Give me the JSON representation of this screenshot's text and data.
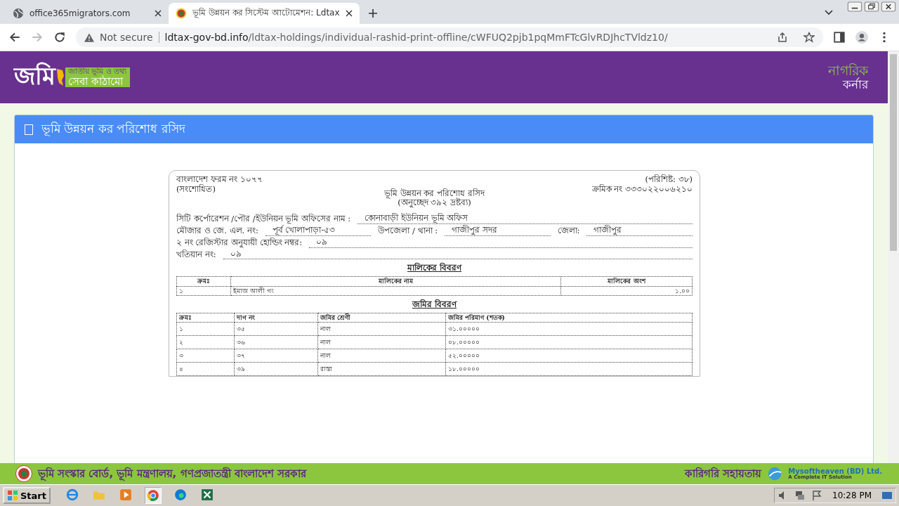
{
  "browser": {
    "tabs": [
      {
        "title": "office365migrators.com",
        "selected": false
      },
      {
        "title": "ভূমি উন্নয়ন কর সিস্টেম আটোমেশন: Ldtax",
        "selected": true
      }
    ],
    "address": {
      "security": "Not secure",
      "domain": "ldtax-gov-bd.info",
      "path": "/ldtax-holdings/individual-rashid-print-offline/cWFUQ2pjb1pqMmFTcGlvRDJhcTVldz10/"
    }
  },
  "header": {
    "logo": {
      "word": "জমি",
      "tagline_1": "জাতীয় ভূমি ও তথ্য",
      "tagline_2": "সেবা কাঠামো"
    },
    "corner": {
      "line_1": "নাগরিক",
      "line_2": "কর্নার"
    }
  },
  "panel": {
    "title": "ভূমি উন্নয়ন কর পরিশোধ রসিদ"
  },
  "receipt": {
    "form_no": "বাংলাদেশ ফরম নং ১০৭৭",
    "amended": "(সংশোধিত)",
    "appendix": "(পরিশিষ্ট: ৩৮)",
    "serial": "ক্রমিক নং ৩৩৩০২২০০৬২১০",
    "title": "ভূমি উন্নয়ন কর পরিশোধ রসিদ",
    "subtitle": "(অনুচ্ছেদ ৩৯২ দ্রষ্টব্য)",
    "fields": [
      [
        {
          "label": "সিটি কর্পোরেশন /পৌর /ইউনিয়ন ভূমি অফিসের নাম :",
          "value": "কোনাবাড়ী ইউনিয়ন ভূমি অফিস"
        }
      ],
      [
        {
          "label": "মৌজার ও জে. এল. নং:",
          "value": "পূর্ব খোলাপাড়া-৫৩"
        },
        {
          "label": "উপজেলা / থানা :",
          "value": "গাজীপুর সদর"
        },
        {
          "label": "জেলা:",
          "value": "গাজীপুর"
        }
      ],
      [
        {
          "label": "২ নং রেজিস্টার অনুযায়ী হোল্ডিং নম্বর:",
          "value": "০৯"
        }
      ],
      [
        {
          "label": "খতিয়ান নং:",
          "value": "০৯"
        }
      ]
    ],
    "owners": {
      "heading": "মালিকের বিবরণ",
      "columns": [
        "ক্রমঃ",
        "মালিকের নাম",
        "মালিকের অংশ"
      ],
      "rows": [
        [
          "১",
          "ইমাজ আলী গং",
          "১.০০"
        ]
      ]
    },
    "land": {
      "heading": "জমির বিবরণ",
      "columns": [
        "ক্রমঃ",
        "দাগ নং",
        "জমির শ্রেণী",
        "জমির পরিমাণ (শতক)"
      ],
      "rows": [
        [
          "১",
          "৩৫",
          "নাল",
          "৩১.০০০০০"
        ],
        [
          "২",
          "৩৬",
          "নাল",
          "০৮.০০০০০"
        ],
        [
          "৩",
          "৩৭",
          "নাল",
          "৫২.০০০০০"
        ],
        [
          "৪",
          "৩৯",
          "রাস্তা",
          "১৮.০০০০০"
        ]
      ]
    }
  },
  "footer": {
    "text": "ভূমি সংস্কার বোর্ড, ভূমি মন্ত্রণালয়, গণপ্রজাতন্ত্রী বাংলাদেশ সরকার",
    "support": "কারিগরি সহায়তায়",
    "company": "Mysoftheaven (BD) Ltd.",
    "company_tagline": "A Complete IT Solution"
  },
  "taskbar": {
    "start": "Start",
    "time": "10:28 PM"
  }
}
